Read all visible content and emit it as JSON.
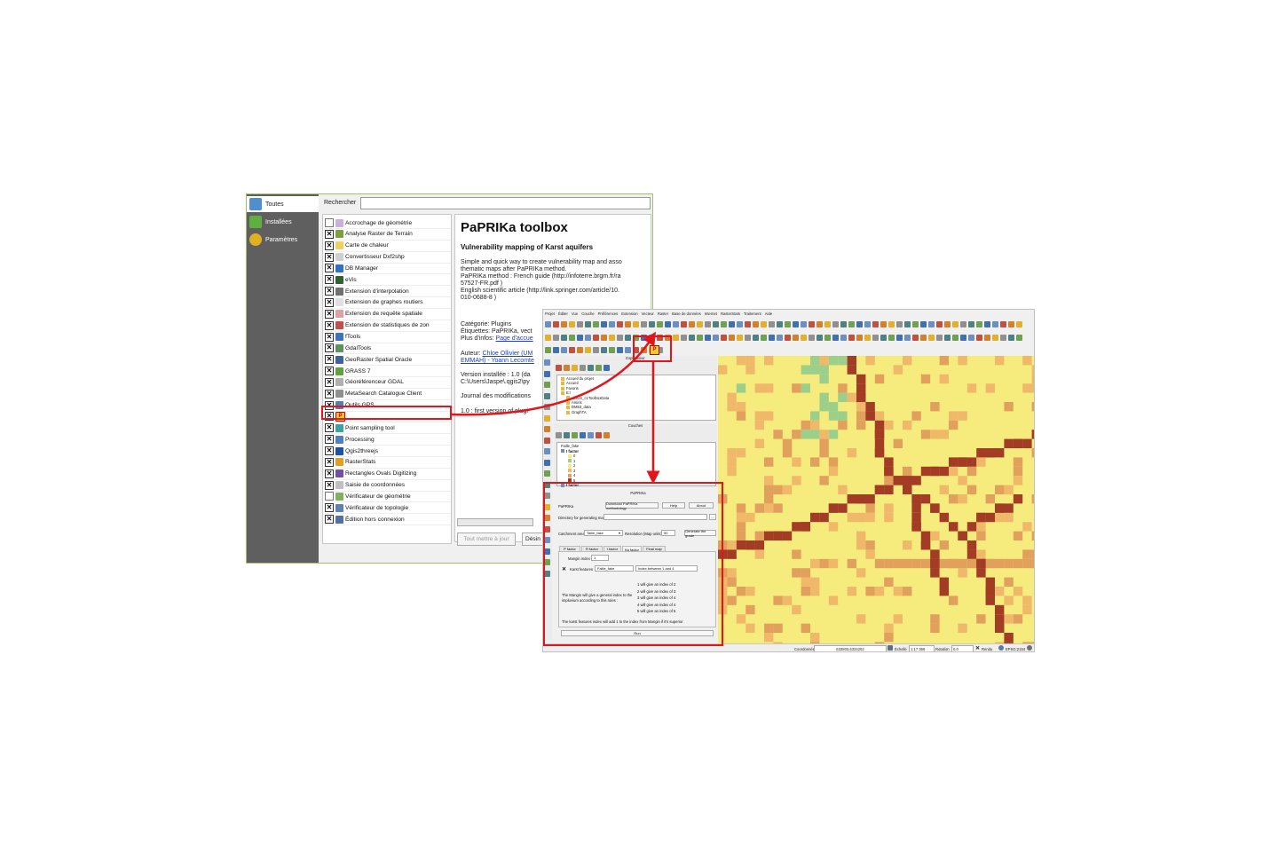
{
  "plugin_manager": {
    "sidebar": [
      {
        "label": "Toutes",
        "icon": "puzzle-icon",
        "color": "#4f8fd0"
      },
      {
        "label": "Installées",
        "icon": "puzzle-green-icon",
        "color": "#60b040"
      },
      {
        "label": "Paramètres",
        "icon": "gear-icon",
        "color": "#e0b020"
      }
    ],
    "search_label": "Rechercher",
    "search_value": "",
    "plugins": [
      {
        "label": "Accrochage de géométrie",
        "checked": false,
        "icon_color": "#c8b0e0"
      },
      {
        "label": "Analyse Raster de Terrain",
        "checked": true,
        "icon_color": "#7aa040"
      },
      {
        "label": "Carte de chaleur",
        "checked": true,
        "icon_color": "#f0d060"
      },
      {
        "label": "Convertisseur Dxf2shp",
        "checked": true,
        "icon_color": "#d0d0d0"
      },
      {
        "label": "DB Manager",
        "checked": true,
        "icon_color": "#3070c0"
      },
      {
        "label": "eVis",
        "checked": true,
        "icon_color": "#306030"
      },
      {
        "label": "Extension d'interpolation",
        "checked": true,
        "icon_color": "#707070"
      },
      {
        "label": "Extension de graphes routiers",
        "checked": true,
        "icon_color": "#e0e0e0"
      },
      {
        "label": "Extension de requête spatiale",
        "checked": true,
        "icon_color": "#e0a0a0"
      },
      {
        "label": "Extension de statistiques de zon",
        "checked": true,
        "icon_color": "#c05050"
      },
      {
        "label": "fTools",
        "checked": true,
        "icon_color": "#4070c0"
      },
      {
        "label": "GdalTools",
        "checked": true,
        "icon_color": "#609060"
      },
      {
        "label": "GeoRaster Spatial Oracle",
        "checked": true,
        "icon_color": "#4060a0"
      },
      {
        "label": "GRASS 7",
        "checked": true,
        "icon_color": "#60a040"
      },
      {
        "label": "Géoréférenceur GDAL",
        "checked": true,
        "icon_color": "#b0b0b0"
      },
      {
        "label": "MetaSearch Catalogue Client",
        "checked": true,
        "icon_color": "#909090"
      },
      {
        "label": "Outils GPS",
        "checked": true,
        "icon_color": "#5080b0"
      },
      {
        "label": "",
        "checked": true,
        "icon_color": "#e8d020",
        "icon": "paprika-icon",
        "highlighted": true
      },
      {
        "label": "Point sampling tool",
        "checked": true,
        "icon_color": "#40a0a0"
      },
      {
        "label": "Processing",
        "checked": true,
        "icon_color": "#5080c0"
      },
      {
        "label": "Qgis2threejs",
        "checked": true,
        "icon_color": "#2050a0"
      },
      {
        "label": "RasterStats",
        "checked": true,
        "icon_color": "#e0a020"
      },
      {
        "label": "Rectangles Ovals Digitizing",
        "checked": true,
        "icon_color": "#7050a0"
      },
      {
        "label": "Saisie de coordonnées",
        "checked": true,
        "icon_color": "#c0c0c0"
      },
      {
        "label": "Vérificateur de géométrie",
        "checked": false,
        "icon_color": "#80b060"
      },
      {
        "label": "Vérificateur de topologie",
        "checked": true,
        "icon_color": "#6080b0"
      },
      {
        "label": "Édition hors connexion",
        "checked": true,
        "icon_color": "#5070a0"
      }
    ],
    "detail": {
      "title": "PaPRIKa toolbox",
      "subtitle": "Vulnerability mapping of Karst aquifers",
      "desc_lines": [
        "Simple and quick way to create vulnerability map and asso",
        "thematic maps after PaPRIKa method.",
        "PaPRIKa method : French guide (http://infoterre.brgm.fr/ra",
        "57527-FR.pdf )",
        "English scientific article (http://link.springer.com/article/10.",
        "010-0688-8 )"
      ],
      "category": "Catégorie: Plugins",
      "tags": "Étiquettes: PaPRIKa, vect",
      "more_info_label": "Plus d'infos: ",
      "more_info_link": "Page d'accue",
      "author_label": "Auteur: ",
      "author_link_1": "Chloe Ollivier (UM",
      "author_link_2": "EMMAH) - Yoann Lecomte",
      "installed_version": "Version installée : 1.0 (da",
      "install_path": "C:\\Users\\Jaspe\\.qgis2\\py",
      "changelog_title": "Journal des modifications",
      "changelog_entry": "1.0 : first version of plugi"
    },
    "buttons": {
      "update_all": "Tout mettre à jour",
      "uninstall": "Désin"
    }
  },
  "qgis": {
    "menus": [
      "Projet",
      "Éditer",
      "Vue",
      "Couche",
      "Préférences",
      "Extension",
      "Vecteur",
      "Raster",
      "Base de données",
      "Internet",
      "RasterStats",
      "Traitement",
      "Aide"
    ],
    "browser_panel_title": "Explorateur",
    "browser_items": [
      "Accueil du projet",
      "Accueil",
      "Favoris",
      "E:\\",
      "afrIGS_c1ToolboxData",
      "Amiris",
      "DM53_data",
      "GraphTA"
    ],
    "layers_panel_title": "Couches",
    "layer_items": [
      "Faille_fake",
      "I factor",
      "0",
      "1",
      "2",
      "3",
      "4",
      "5",
      "I factor"
    ],
    "paprika": {
      "title": "PaPRIKa",
      "name": "PaPRIKa",
      "download_btn": "Download PaPRIKa methodology",
      "help_btn": "Help",
      "about_btn": "About",
      "dir_label": "Directory for generating maps",
      "dir_value": "",
      "browse_btn": "...",
      "catchment_label": "Catchment area",
      "catchment_value": "Taille_fake",
      "resolution_label": "Resolution (Map units)",
      "resolution_value": "50",
      "generate_btn": "Generate the grade",
      "tabs": [
        "P factor",
        "R factor",
        "I factor",
        "Ka factor",
        "Final map"
      ],
      "active_tab": "Ka factor",
      "mangin_label": "Mangin index",
      "mangin_value": "1",
      "karst_label": "Karst features",
      "karst_value": "Faille_fake",
      "index_value": "Index between 1 and 4",
      "legend_lines": [
        "1 will give an index of 2",
        "2 will give an index of 3",
        "3 will give an index of 4",
        "4 will give an index of 4",
        "5 will give an index of 5"
      ],
      "mangin_note_1": "The Mangin will give a general index to the",
      "mangin_note_2": "impluvium according to this rules :",
      "karst_note": "The karst features index will add 1 to the index from Mangin if it's superior",
      "run_btn": "Run"
    },
    "status": {
      "coord_label": "Coordonnée",
      "coord_value": "633803,6334202",
      "scale_label": "Échelle",
      "scale_value": "1:17 366",
      "rotation_label": "Rotation",
      "rotation_value": "0.0",
      "render_label": "Rendu",
      "crs": "EPSG:2154"
    },
    "map_colors": {
      "background": "#f6ec7d",
      "light_orange": "#f0b96a",
      "orange": "#e2a05d",
      "dark_red": "#a33c24",
      "green": "#9ccf8a"
    }
  },
  "highlight_color": "#e0161c"
}
